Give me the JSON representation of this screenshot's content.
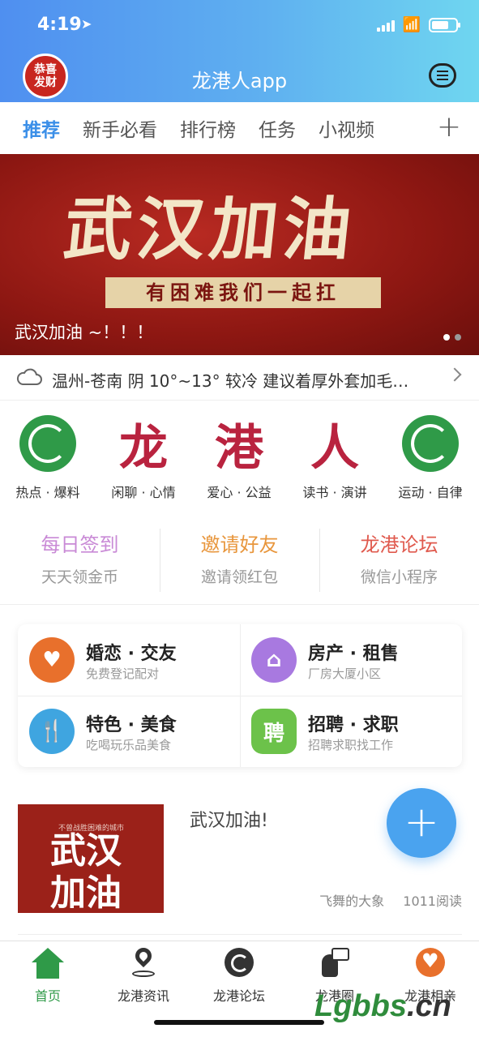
{
  "status": {
    "time": "4:19"
  },
  "header": {
    "title": "龙港人app",
    "avatar_text_1": "恭喜",
    "avatar_text_2": "发财"
  },
  "tabs": [
    {
      "label": "推荐",
      "active": true
    },
    {
      "label": "新手必看"
    },
    {
      "label": "排行榜"
    },
    {
      "label": "任务"
    },
    {
      "label": "小视频"
    }
  ],
  "tabs_add": "+",
  "banner": {
    "headline": "武汉加油",
    "strip": "有困难我们一起扛",
    "caption": "武汉加油 ~！！！"
  },
  "weather": {
    "text": "温州-苍南 阴 10°~13° 较冷 建议着厚外套加毛…"
  },
  "quick": [
    {
      "label": "热点 · 爆料",
      "icon": "dragon-green-icon"
    },
    {
      "label": "闲聊 · 心情",
      "icon_char": "龙"
    },
    {
      "label": "爱心 · 公益",
      "icon_char": "港"
    },
    {
      "label": "读书 · 演讲",
      "icon_char": "人"
    },
    {
      "label": "运动 · 自律",
      "icon": "dragon-green-icon"
    }
  ],
  "services": [
    {
      "title": "每日签到",
      "sub": "天天领金币",
      "color": "#c98ad6"
    },
    {
      "title": "邀请好友",
      "sub": "邀请领红包",
      "color": "#e8963c"
    },
    {
      "title": "龙港论坛",
      "sub": "微信小程序",
      "color": "#e05a4e"
    }
  ],
  "cards": [
    {
      "title": "婚恋 · 交友",
      "sub": "免费登记配对",
      "icon_color": "#e8702c",
      "icon": "heart-pulse-icon"
    },
    {
      "title": "房产 · 租售",
      "sub": "厂房大厦小区",
      "icon_color": "#a879e0",
      "icon": "house-icon"
    },
    {
      "title": "特色 · 美食",
      "sub": "吃喝玩乐品美食",
      "icon_color": "#3fa5e0",
      "icon": "fork-knife-icon"
    },
    {
      "title": "招聘 · 求职",
      "sub": "招聘求职找工作",
      "icon_color": "#6cc24a",
      "icon_char": "聘"
    }
  ],
  "post": {
    "thumb_small": "不曾战胜困难的城市",
    "thumb_line1": "武汉",
    "thumb_line2": "加油",
    "title": "武汉加油!",
    "author": "飞舞的大象",
    "reads": "1011阅读"
  },
  "fab": "+",
  "nav": [
    {
      "label": "首页",
      "active": true
    },
    {
      "label": "龙港资讯"
    },
    {
      "label": "龙港论坛"
    },
    {
      "label": "龙港圈"
    },
    {
      "label": "龙港相亲"
    }
  ],
  "watermark": {
    "a": "Lgbbs",
    "b": ".cn"
  }
}
